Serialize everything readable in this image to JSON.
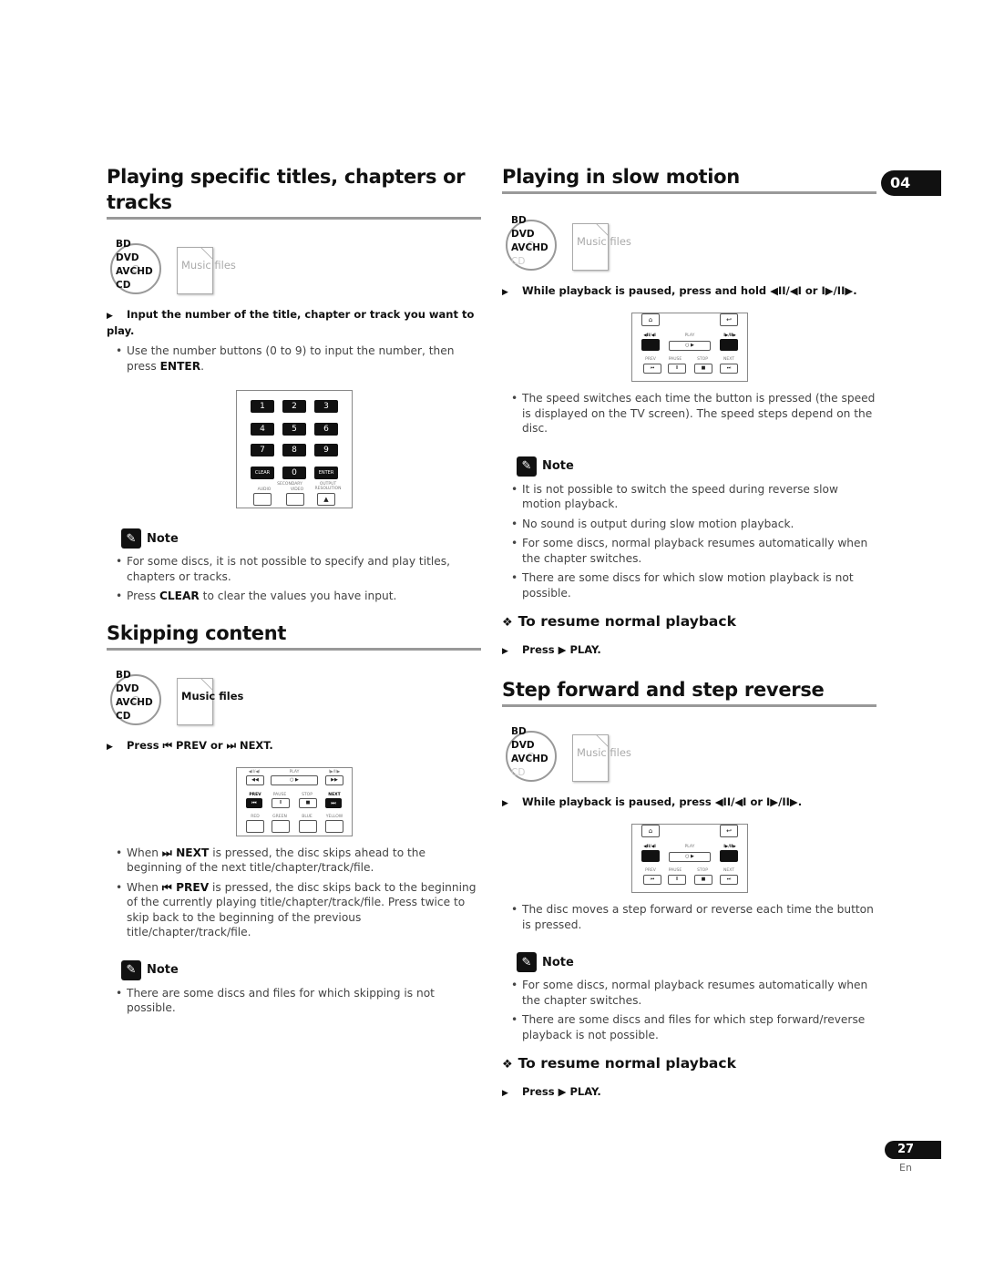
{
  "chapter": "04",
  "page": {
    "number": "27",
    "lang": "En"
  },
  "media_labels": [
    "BD",
    "DVD",
    "AVCHD",
    "CD"
  ],
  "music_files_label": "Music files",
  "note_label": "Note",
  "left": {
    "s1": {
      "title": "Playing specific titles, chapters or tracks",
      "step": "Input the number of the title, chapter or track you want to play.",
      "bullet_pre": "Use the number buttons (0 to 9) to input the number, then press ",
      "bullet_bold": "ENTER",
      "bullet_post": ".",
      "numpad": {
        "keys": [
          "1",
          "2",
          "3",
          "4",
          "5",
          "6",
          "7",
          "8",
          "9",
          "CLEAR",
          "0",
          "ENTER"
        ],
        "secondary": "SECONDARY",
        "audio": "AUDIO",
        "video": "VIDEO",
        "output_resolution": "OUTPUT RESOLUTION",
        "up_arrow": "▲"
      },
      "notes": [
        {
          "pre": "For some discs, it is not possible to specify and play titles, chapters or tracks.",
          "bold": "",
          "post": ""
        },
        {
          "pre": "Press ",
          "bold": "CLEAR",
          "post": " to clear the values you have input."
        }
      ]
    },
    "s2": {
      "title": "Skipping content",
      "step_pre": "Press ",
      "step_prev": "⏮ PREV",
      "step_or": " or ",
      "step_next": "⏭ NEXT.",
      "remote": {
        "top_labels": [
          "◀II/◀I",
          "PLAY",
          "I▶/II▶"
        ],
        "mid_labels": [
          "PREV",
          "PAUSE",
          "STOP",
          "NEXT"
        ],
        "mid_glyphs": [
          "⏮",
          "II",
          "■",
          "⏭"
        ],
        "color_labels": [
          "RED",
          "GREEN",
          "BLUE",
          "YELLOW"
        ],
        "play_glyph": "○ ▶",
        "rew_glyph": "◀◀",
        "ff_glyph": "▶▶"
      },
      "bullets": [
        {
          "pre": "When ",
          "bold": "⏭ NEXT",
          "post": " is pressed, the disc skips ahead to the beginning of the next title/chapter/track/file."
        },
        {
          "pre": "When ",
          "bold": "⏮ PREV",
          "post": " is pressed, the disc skips back to the beginning of the currently playing title/chapter/track/file. Press twice to skip back to the beginning of the previous title/chapter/track/file."
        }
      ],
      "notes": [
        "There are some discs and files for which skipping is not possible."
      ]
    }
  },
  "right": {
    "s3": {
      "title": "Playing in slow motion",
      "step": "While playback is paused, press and hold ◀II/◀I or I▶/II▶.",
      "bullets": [
        "The speed switches each time the button is pressed (the speed is displayed on the TV screen). The speed steps depend on the disc."
      ],
      "notes": [
        "It is not possible to switch the speed during reverse slow motion playback.",
        "No sound is output during slow motion playback.",
        "For some discs, normal playback resumes automatically when the chapter switches.",
        "There are some discs for which slow motion playback is not possible."
      ],
      "resume_title": "To resume normal playback",
      "resume_step": "Press ▶ PLAY."
    },
    "s4": {
      "title": "Step forward and step reverse",
      "step": "While playback is paused, press ◀II/◀I or I▶/II▶.",
      "bullets": [
        "The disc moves a step forward or reverse each time the button is pressed."
      ],
      "notes": [
        "For some discs, normal playback resumes automatically when the chapter switches.",
        "There are some discs and files for which step forward/reverse playback is not possible."
      ],
      "resume_title": "To resume normal playback",
      "resume_step": "Press ▶ PLAY."
    },
    "remote": {
      "home_glyph": "⌂",
      "return_glyph": "↩",
      "top_labels": [
        "◀II/◀I",
        "PLAY",
        "I▶/II▶"
      ],
      "play_glyph": "○ ▶",
      "mid_labels": [
        "PREV",
        "PAUSE",
        "STOP",
        "NEXT"
      ],
      "mid_glyphs": [
        "⏮",
        "II",
        "■",
        "⏭"
      ]
    }
  }
}
